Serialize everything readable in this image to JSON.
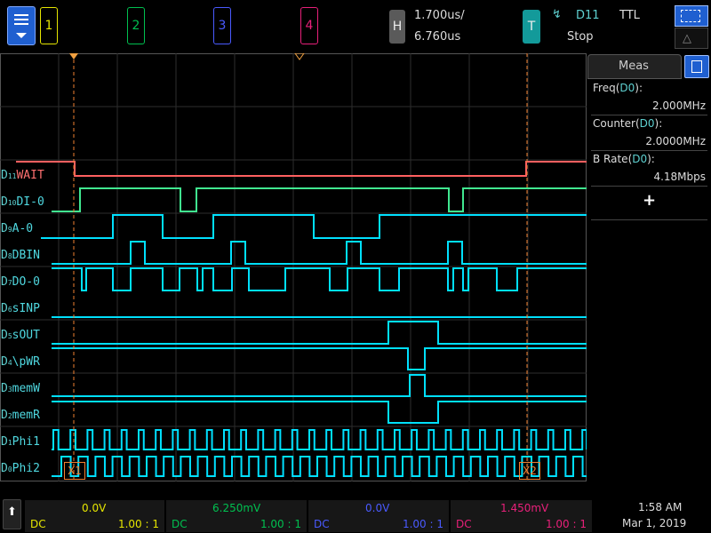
{
  "topbar": {
    "channels": [
      {
        "label": "1",
        "color": "#e6e600"
      },
      {
        "label": "2",
        "color": "#00c050"
      },
      {
        "label": "3",
        "color": "#4a5aff"
      },
      {
        "label": "4",
        "color": "#e8207a"
      }
    ],
    "horizontal": {
      "button": "H",
      "scale": "1.700us/",
      "position": "6.760us"
    },
    "trigger": {
      "button": "T",
      "source": "D11",
      "type": "TTL",
      "status": "Stop"
    }
  },
  "measurements": {
    "title": "Meas",
    "items": [
      {
        "label": "Freq(",
        "src": "D0",
        "suffix": "):",
        "value": "2.000MHz"
      },
      {
        "label": "Counter(",
        "src": "D0",
        "suffix": "):",
        "value": "2.0000MHz"
      },
      {
        "label": "B Rate(",
        "src": "D0",
        "suffix": "):",
        "value": "4.18Mbps"
      }
    ],
    "add": "+"
  },
  "digital_channels": [
    {
      "num": "11",
      "name": "WAIT"
    },
    {
      "num": "10",
      "name": "DI-0"
    },
    {
      "num": "9",
      "name": "A-0"
    },
    {
      "num": "8",
      "name": "DBIN"
    },
    {
      "num": "7",
      "name": "DO-0"
    },
    {
      "num": "6",
      "name": "sINP"
    },
    {
      "num": "5",
      "name": "sOUT"
    },
    {
      "num": "4",
      "name": "\\pWR"
    },
    {
      "num": "3",
      "name": "memW"
    },
    {
      "num": "2",
      "name": "memR"
    },
    {
      "num": "1",
      "name": "Phi1"
    },
    {
      "num": "0",
      "name": "Phi2"
    }
  ],
  "cursors": {
    "x1": "X1",
    "x2": "X2"
  },
  "bottom": {
    "channels": [
      {
        "offset": "0.0V",
        "coupling": "DC",
        "ratio": "1.00 : 1",
        "color": "#e6e600"
      },
      {
        "offset": "6.250mV",
        "coupling": "DC",
        "ratio": "1.00 : 1",
        "color": "#00c050"
      },
      {
        "offset": "0.0V",
        "coupling": "DC",
        "ratio": "1.00 : 1",
        "color": "#4a5aff"
      },
      {
        "offset": "1.450mV",
        "coupling": "DC",
        "ratio": "1.00 : 1",
        "color": "#e8207a"
      }
    ],
    "time": "1:58 AM",
    "date": "Mar 1, 2019"
  },
  "colors": {
    "wait": "#ff5a5a",
    "digital": "#00e0ff",
    "di0": "#40e890"
  }
}
